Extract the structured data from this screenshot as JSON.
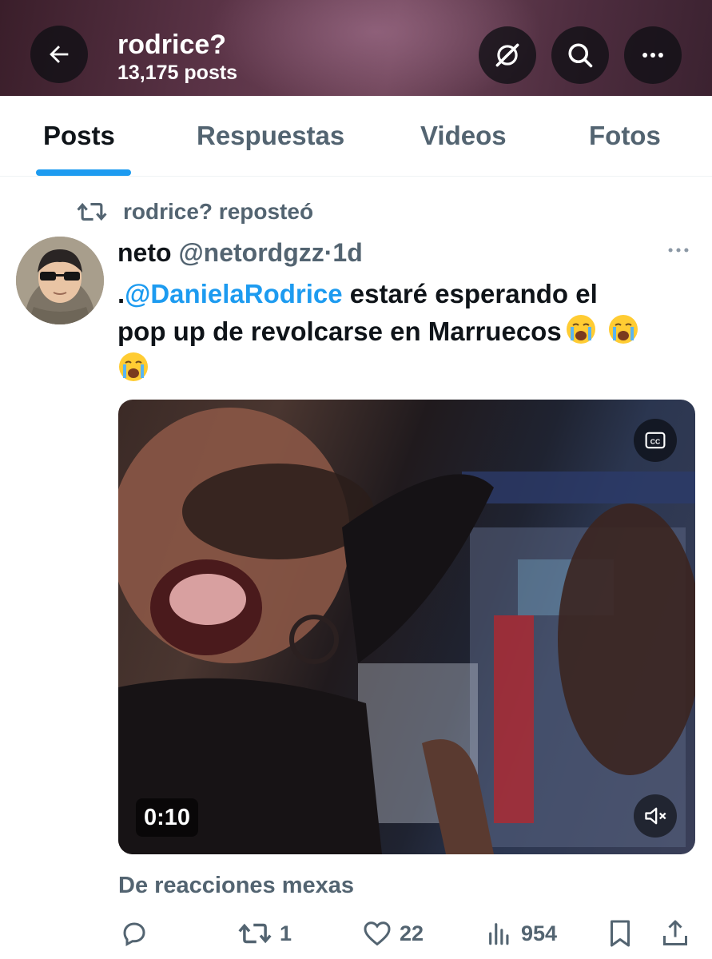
{
  "header": {
    "title": "rodrice?",
    "subtitle": "13,175 posts",
    "icons": [
      "back-arrow-icon",
      "grok-icon",
      "search-icon",
      "more-icon"
    ]
  },
  "tabs": [
    {
      "label": "Posts",
      "active": true
    },
    {
      "label": "Respuestas",
      "active": false
    },
    {
      "label": "Videos",
      "active": false
    },
    {
      "label": "Fotos",
      "active": false
    }
  ],
  "tweet": {
    "repost_label": "rodrice? reposteó",
    "author_name": "neto",
    "author_handle": "@netordgzz",
    "separator": "·",
    "time": "1d",
    "text_prefix": ".",
    "mention": "@DanielaRodrice",
    "text_line1_rest": " estaré esperando el",
    "text_line2": "pop up de revolcarse en Marruecos",
    "emoji_name": "loudly-crying-face-emoji",
    "video": {
      "duration": "0:10",
      "cc_icon": "closed-captions-icon",
      "mute_icon": "muted-speaker-icon"
    },
    "caption": "De reacciones mexas",
    "actions": {
      "reply_count": "",
      "repost_count": "1",
      "like_count": "22",
      "views_count": "954"
    }
  },
  "colors": {
    "accent": "#1d9bf0",
    "text_primary": "#0f1419",
    "text_secondary": "#536471"
  }
}
